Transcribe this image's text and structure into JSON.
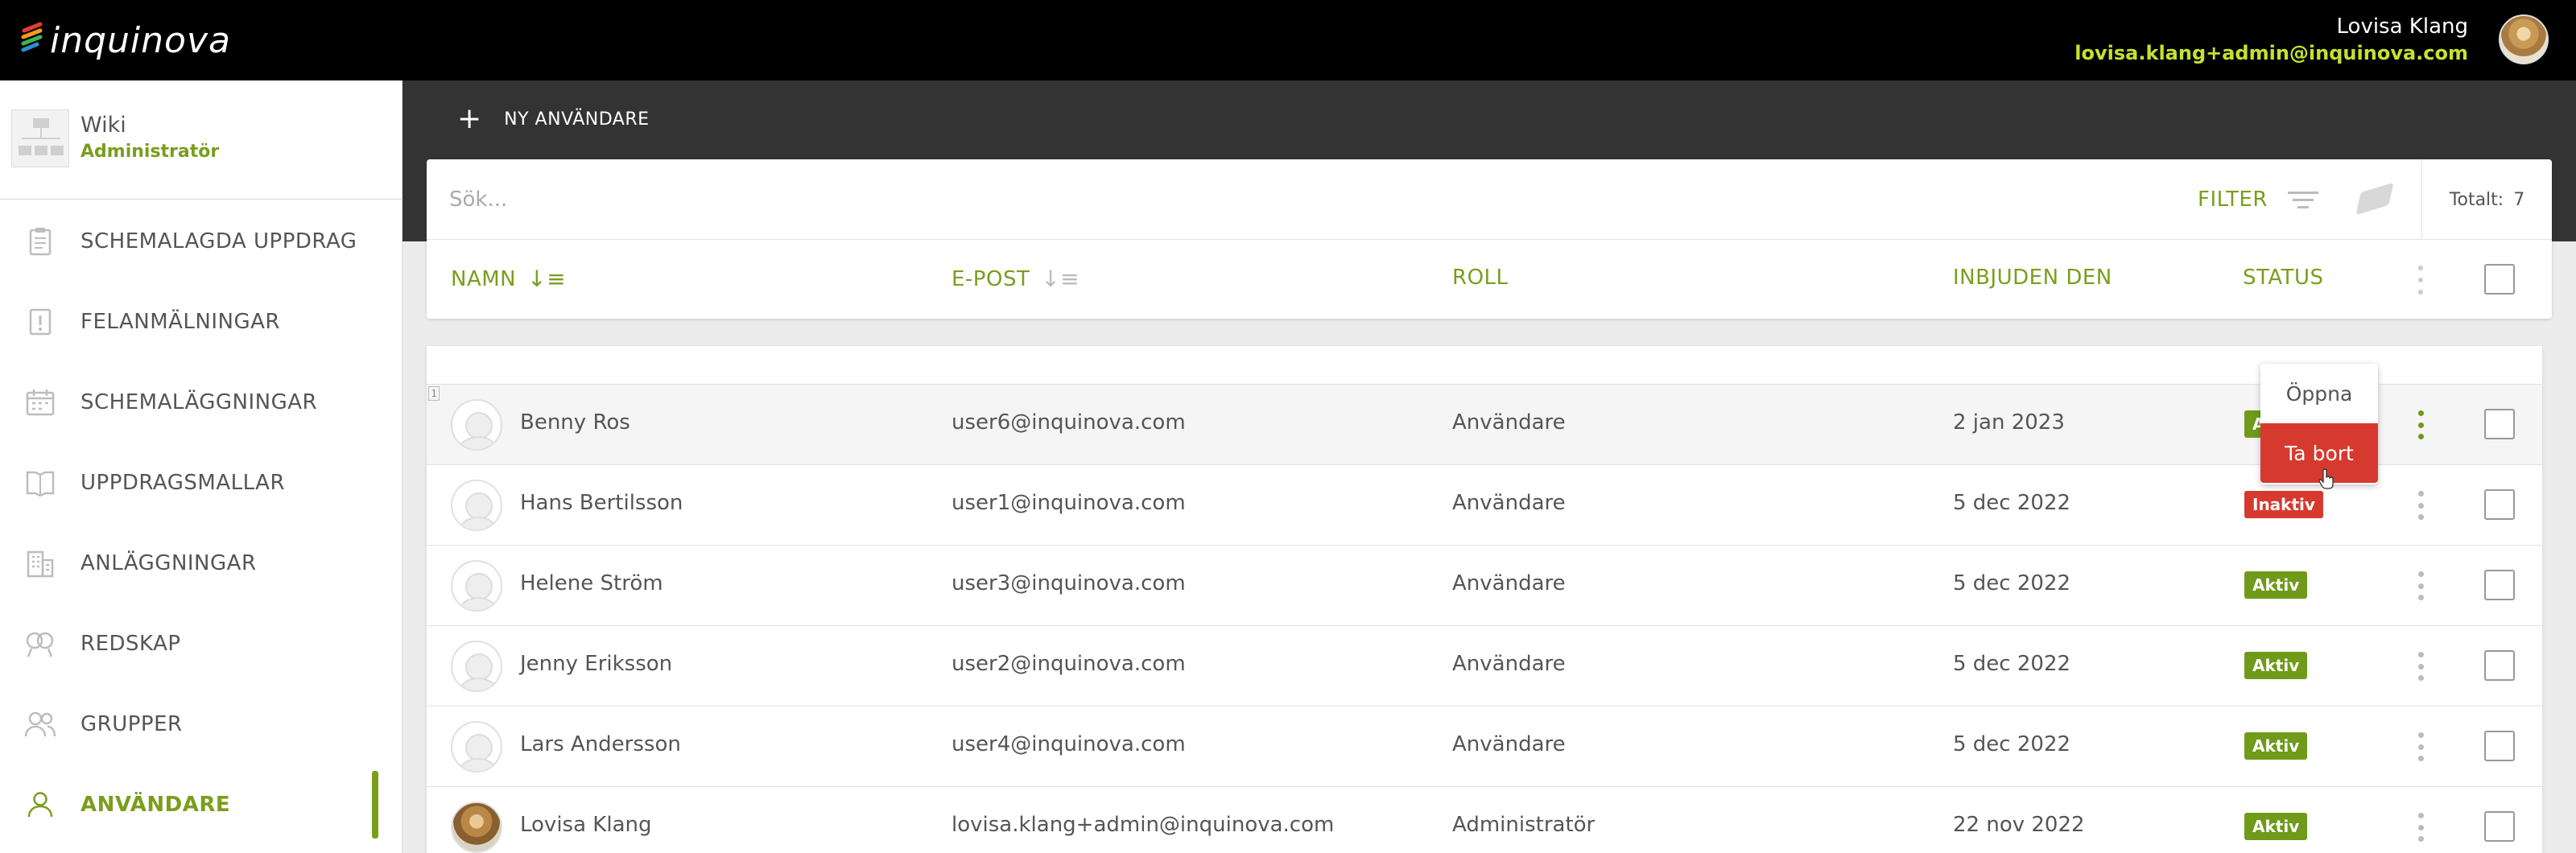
{
  "brand": {
    "logo_text": "inquinova"
  },
  "account": {
    "name": "Lovisa Klang",
    "email": "lovisa.klang+admin@inquinova.com"
  },
  "workspace": {
    "title": "Wiki",
    "role": "Administratör"
  },
  "sidebar": {
    "items": [
      {
        "label": "SCHEMALAGDA UPPDRAG",
        "icon": "clipboard-icon",
        "active": false
      },
      {
        "label": "FELANMÄLNINGAR",
        "icon": "alert-note-icon",
        "active": false
      },
      {
        "label": "SCHEMALÄGGNINGAR",
        "icon": "calendar-icon",
        "active": false
      },
      {
        "label": "UPPDRAGSMALLAR",
        "icon": "book-icon",
        "active": false
      },
      {
        "label": "ANLÄGGNINGAR",
        "icon": "building-icon",
        "active": false
      },
      {
        "label": "REDSKAP",
        "icon": "tools-icon",
        "active": false
      },
      {
        "label": "GRUPPER",
        "icon": "group-icon",
        "active": false
      },
      {
        "label": "ANVÄNDARE",
        "icon": "user-icon",
        "active": true
      }
    ]
  },
  "toolbar": {
    "new_user_label": "NY ANVÄNDARE"
  },
  "search": {
    "placeholder": "Sök...",
    "value": ""
  },
  "filter": {
    "label": "FILTER"
  },
  "total": {
    "label": "Totalt:",
    "count": "7"
  },
  "columns": {
    "name": "NAMN",
    "email": "E-POST",
    "role": "ROLL",
    "invited": "INBJUDEN DEN",
    "status": "STATUS"
  },
  "rows": [
    {
      "index": "1",
      "name": "Benny Ros",
      "email": "user6@inquinova.com",
      "role": "Användare",
      "invited": "2 jan 2023",
      "status": "Aktiv",
      "status_color": "#6f9a1a"
    },
    {
      "name": "Hans Bertilsson",
      "email": "user1@inquinova.com",
      "role": "Användare",
      "invited": "5 dec 2022",
      "status": "Inaktiv",
      "status_color": "#d63a2f"
    },
    {
      "name": "Helene Ström",
      "email": "user3@inquinova.com",
      "role": "Användare",
      "invited": "5 dec 2022",
      "status": "Aktiv",
      "status_color": "#6f9a1a"
    },
    {
      "name": "Jenny Eriksson",
      "email": "user2@inquinova.com",
      "role": "Användare",
      "invited": "5 dec 2022",
      "status": "Aktiv",
      "status_color": "#6f9a1a"
    },
    {
      "name": "Lars Andersson",
      "email": "user4@inquinova.com",
      "role": "Användare",
      "invited": "5 dec 2022",
      "status": "Aktiv",
      "status_color": "#6f9a1a"
    },
    {
      "name": "Lovisa Klang",
      "email": "lovisa.klang+admin@inquinova.com",
      "role": "Administratör",
      "invited": "22 nov 2022",
      "status": "Aktiv",
      "status_color": "#6f9a1a"
    }
  ],
  "row_menu": {
    "open_label": "Öppna",
    "delete_label": "Ta bort"
  },
  "colors": {
    "accent": "#7a9e1c",
    "danger": "#d63a2f",
    "email_highlight": "#c4e32b"
  }
}
